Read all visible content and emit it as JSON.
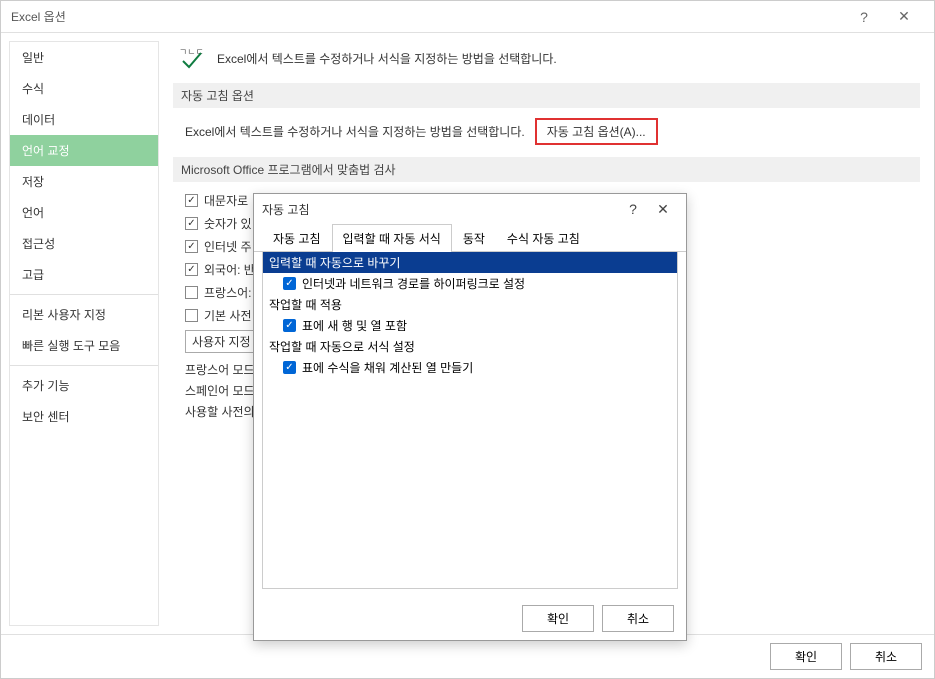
{
  "window": {
    "title": "Excel 옵션"
  },
  "sidebar": {
    "items": [
      {
        "label": "일반"
      },
      {
        "label": "수식"
      },
      {
        "label": "데이터"
      },
      {
        "label": "언어 교정"
      },
      {
        "label": "저장"
      },
      {
        "label": "언어"
      },
      {
        "label": "접근성"
      },
      {
        "label": "고급"
      }
    ],
    "items2": [
      {
        "label": "리본 사용자 지정"
      },
      {
        "label": "빠른 실행 도구 모음"
      }
    ],
    "items3": [
      {
        "label": "추가 기능"
      },
      {
        "label": "보안 센터"
      }
    ]
  },
  "content": {
    "intro": "Excel에서 텍스트를 수정하거나 서식을 지정하는 방법을 선택합니다.",
    "section1": {
      "header": "자동 고침 옵션",
      "row_text": "Excel에서 텍스트를 수정하거나 서식을 지정하는 방법을 선택합니다.",
      "button": "자동 고침 옵션(A)..."
    },
    "section2": {
      "header": "Microsoft Office 프로그램에서 맞춤법 검사",
      "checks": [
        {
          "label": "대문자로",
          "checked": true
        },
        {
          "label": "숫자가 있",
          "checked": true
        },
        {
          "label": "인터넷 주",
          "checked": true
        },
        {
          "label": "외국어: 반",
          "checked": true
        },
        {
          "label": "프랑스어:",
          "checked": false
        },
        {
          "label": "기본 사전",
          "checked": false
        }
      ],
      "custom_button": "사용자 지정",
      "subs": [
        "프랑스어 모드",
        "스페인어 모드",
        "사용할 사전의"
      ]
    }
  },
  "footer": {
    "ok": "확인",
    "cancel": "취소"
  },
  "dialog": {
    "title": "자동 고침",
    "tabs": [
      {
        "label": "자동 고침"
      },
      {
        "label": "입력할 때 자동 서식"
      },
      {
        "label": "동작"
      },
      {
        "label": "수식 자동 고침"
      }
    ],
    "activeTab": 1,
    "groups": [
      {
        "header": "입력할 때 자동으로 바꾸기",
        "highlighted": true,
        "items": [
          {
            "label": "인터넷과 네트워크 경로를 하이퍼링크로 설정",
            "checked": true
          }
        ]
      },
      {
        "header": "작업할 때 적용",
        "highlighted": false,
        "items": [
          {
            "label": "표에 새 행 및 열 포함",
            "checked": true
          }
        ]
      },
      {
        "header": "작업할 때 자동으로 서식 설정",
        "highlighted": false,
        "items": [
          {
            "label": "표에 수식을 채워 계산된 열 만들기",
            "checked": true
          }
        ]
      }
    ],
    "ok": "확인",
    "cancel": "취소"
  }
}
